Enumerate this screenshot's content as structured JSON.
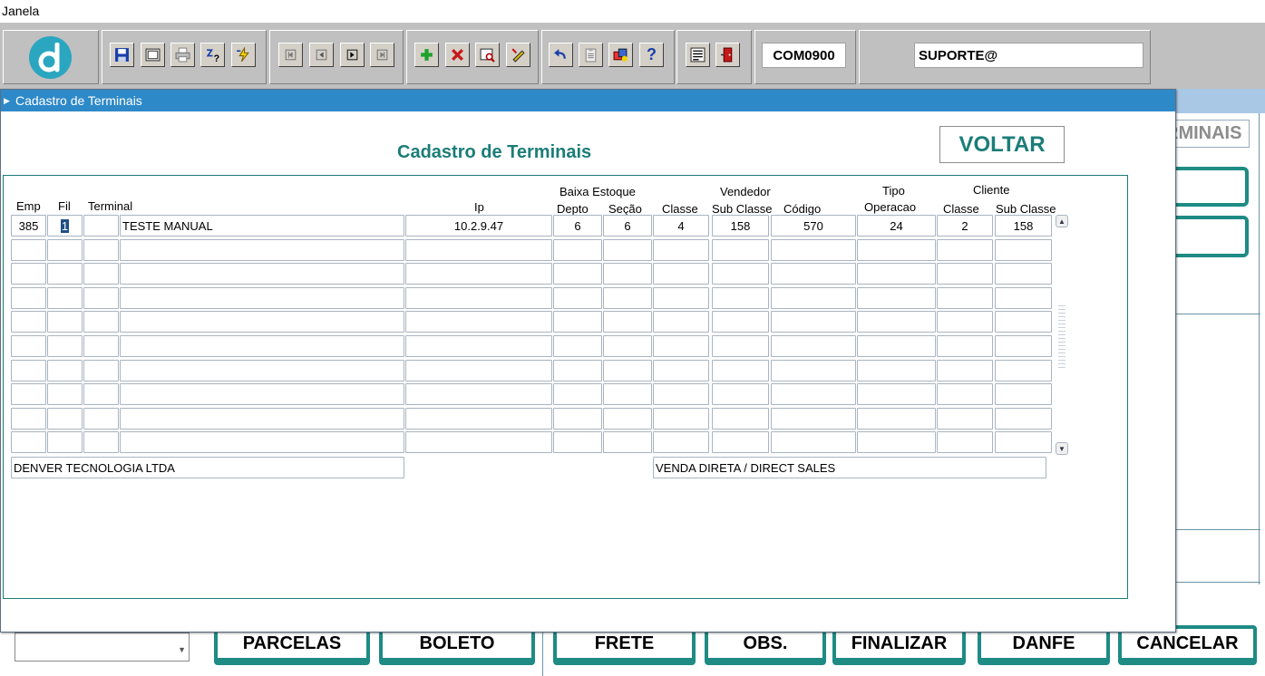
{
  "menubar": {
    "janela": "Janela"
  },
  "toolbar": {
    "program_code": "COM0900",
    "user": "SUPORTE@",
    "help_label": "?"
  },
  "background": {
    "terminais_fragment": "RMINAIS",
    "buttons": {
      "parcelas": "PARCELAS",
      "boleto": "BOLETO",
      "frete": "FRETE",
      "obs": "OBS.",
      "finalizar": "FINALIZAR",
      "danfe": "DANFE",
      "cancelar": "CANCELAR"
    }
  },
  "window": {
    "title": "Cadastro de Terminais",
    "form_title": "Cadastro de Terminais",
    "voltar": "VOLTAR"
  },
  "grid": {
    "group_headers": {
      "baixa_estoque": "Baixa Estoque",
      "vendedor": "Vendedor",
      "tipo": "Tipo",
      "cliente": "Cliente"
    },
    "columns": {
      "emp": "Emp",
      "fil": "Fil",
      "terminal": "Terminal",
      "ip": "Ip",
      "depto": "Depto",
      "secao": "Seção",
      "classe": "Classe",
      "vend_subclasse": "Sub Classe",
      "codigo": "Código",
      "operacao": "Operacao",
      "cli_classe": "Classe",
      "cli_subclasse": "Sub Classe"
    },
    "rows": [
      {
        "emp": "385",
        "fil": "1",
        "terminal_code": "",
        "terminal_name": "TESTE MANUAL",
        "ip": "10.2.9.47",
        "depto": "6",
        "secao": "6",
        "classe": "4",
        "vend_subclasse": "158",
        "codigo": "570",
        "operacao": "24",
        "cli_classe": "2",
        "cli_subclasse": "158"
      }
    ],
    "empty_rows": 9
  },
  "footer": {
    "empresa_nome": "DENVER TECNOLOGIA LTDA",
    "vendedor_nome": "VENDA DIRETA / DIRECT SALES"
  }
}
